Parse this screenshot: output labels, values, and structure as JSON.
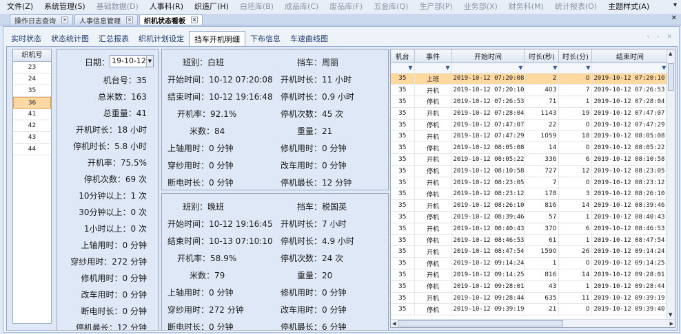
{
  "menu": [
    "文件(Z)",
    "系统管理(S)",
    "基础数据(D)",
    "人事科(R)",
    "织造厂(H)",
    "白坯库(B)",
    "成品库(C)",
    "废品库(F)",
    "五金库(Q)",
    "生产部(P)",
    "业务部(X)",
    "财务科(M)",
    "统计报表(O)",
    "主题样式(A)"
  ],
  "menu_disabled": [
    false,
    false,
    true,
    false,
    false,
    true,
    true,
    true,
    true,
    true,
    true,
    true,
    true,
    false
  ],
  "doc_tabs": [
    "操作日志查询",
    "人事信息管理",
    "织机状态看板"
  ],
  "sub_tabs": [
    "实时状态",
    "状态统计图",
    "汇总报表",
    "织机计划设定",
    "挡车开机明细",
    "下布信息",
    "车速曲线图"
  ],
  "active_sub_tab": 4,
  "machines": {
    "header": "织机号",
    "items": [
      "23",
      "24",
      "35",
      "36",
      "41",
      "42",
      "43",
      "44"
    ],
    "selected": 3
  },
  "summary": {
    "date_label": "日期：",
    "date_value": "19-10-12",
    "rows": [
      "机台号：35",
      "总米数：163",
      "总重量：41",
      "开机时长：18 小时",
      "停机时长：5.8 小时",
      "开机率：75.5%",
      "停机次数：69 次",
      "10分钟以上：1 次",
      "30分钟以上：0 次",
      "1小时以上：0 次",
      "上轴用时：0 分钟",
      "穿纱用时：272 分钟",
      "修机用时：0 分钟",
      "改车用时：0 分钟",
      "断电时长：0 分钟",
      "停机最长：12 分钟"
    ]
  },
  "shift1": {
    "left": [
      "班别：白班",
      "开始时间：10-12 07:20:08",
      "结束时间：10-12 19:16:48",
      "开机率：92.1%",
      "米数：84",
      "上轴用时：0 分钟",
      "穿纱用时：0 分钟",
      "断电时长：0 分钟"
    ],
    "right": [
      "挡车：周丽",
      "开机时长：11 小时",
      "停机时长：0.9 小时",
      "停机次数：45 次",
      "重量：21",
      "修机用时：0 分钟",
      "改车用时：0 分钟",
      "停机最长：12 分钟"
    ]
  },
  "shift2": {
    "left": [
      "班别：晚班",
      "开始时间：10-12 19:16:45",
      "结束时间：10-13 07:10:10",
      "开机率：58.9%",
      "米数：79",
      "上轴用时：0 分钟",
      "穿纱用时：272 分钟",
      "断电时长：0 分钟"
    ],
    "right": [
      "挡车：税国英",
      "开机时长：7 小时",
      "停机时长：4.9 小时",
      "停机次数：24 次",
      "重量：20",
      "修机用时：0 分钟",
      "改车用时：0 分钟",
      "停机最长：6 分钟"
    ]
  },
  "grid": {
    "headers": [
      "机台",
      "事件",
      "开始时间",
      "时长(秒)",
      "时长(分)",
      "结束时间"
    ],
    "filter_icon": "funnel-icon",
    "rows": [
      [
        "35",
        "上班",
        "2019-10-12 07:20:08",
        "2",
        "0",
        "2019-10-12 07:20:10"
      ],
      [
        "35",
        "开机",
        "2019-10-12 07:20:10",
        "403",
        "7",
        "2019-10-12 07:26:53"
      ],
      [
        "35",
        "停机",
        "2019-10-12 07:26:53",
        "71",
        "1",
        "2019-10-12 07:28:04"
      ],
      [
        "35",
        "开机",
        "2019-10-12 07:28:04",
        "1143",
        "19",
        "2019-10-12 07:47:07"
      ],
      [
        "35",
        "停机",
        "2019-10-12 07:47:07",
        "22",
        "0",
        "2019-10-12 07:47:29"
      ],
      [
        "35",
        "开机",
        "2019-10-12 07:47:29",
        "1059",
        "18",
        "2019-10-12 08:05:08"
      ],
      [
        "35",
        "停机",
        "2019-10-12 08:05:08",
        "14",
        "0",
        "2019-10-12 08:05:22"
      ],
      [
        "35",
        "开机",
        "2019-10-12 08:05:22",
        "336",
        "6",
        "2019-10-12 08:10:58"
      ],
      [
        "35",
        "停机",
        "2019-10-12 08:10:58",
        "727",
        "12",
        "2019-10-12 08:23:05"
      ],
      [
        "35",
        "开机",
        "2019-10-12 08:23:05",
        "7",
        "0",
        "2019-10-12 08:23:12"
      ],
      [
        "35",
        "停机",
        "2019-10-12 08:23:12",
        "178",
        "3",
        "2019-10-12 08:26:10"
      ],
      [
        "35",
        "开机",
        "2019-10-12 08:26:10",
        "816",
        "14",
        "2019-10-12 08:39:46"
      ],
      [
        "35",
        "停机",
        "2019-10-12 08:39:46",
        "57",
        "1",
        "2019-10-12 08:40:43"
      ],
      [
        "35",
        "开机",
        "2019-10-12 08:40:43",
        "370",
        "6",
        "2019-10-12 08:46:53"
      ],
      [
        "35",
        "停机",
        "2019-10-12 08:46:53",
        "61",
        "1",
        "2019-10-12 08:47:54"
      ],
      [
        "35",
        "开机",
        "2019-10-12 08:47:54",
        "1590",
        "26",
        "2019-10-12 09:14:24"
      ],
      [
        "35",
        "停机",
        "2019-10-12 09:14:24",
        "1",
        "0",
        "2019-10-12 09:14:25"
      ],
      [
        "35",
        "开机",
        "2019-10-12 09:14:25",
        "816",
        "14",
        "2019-10-12 09:28:01"
      ],
      [
        "35",
        "停机",
        "2019-10-12 09:28:01",
        "43",
        "1",
        "2019-10-12 09:28:44"
      ],
      [
        "35",
        "开机",
        "2019-10-12 09:28:44",
        "635",
        "11",
        "2019-10-12 09:39:19"
      ],
      [
        "35",
        "停机",
        "2019-10-12 09:39:19",
        "21",
        "0",
        "2019-10-12 09:39:40"
      ]
    ],
    "selected_row": 0
  },
  "colors": {
    "selection": "#fdd9a0",
    "panel": "#dfe8f6",
    "accent": "#1e3a6e"
  }
}
